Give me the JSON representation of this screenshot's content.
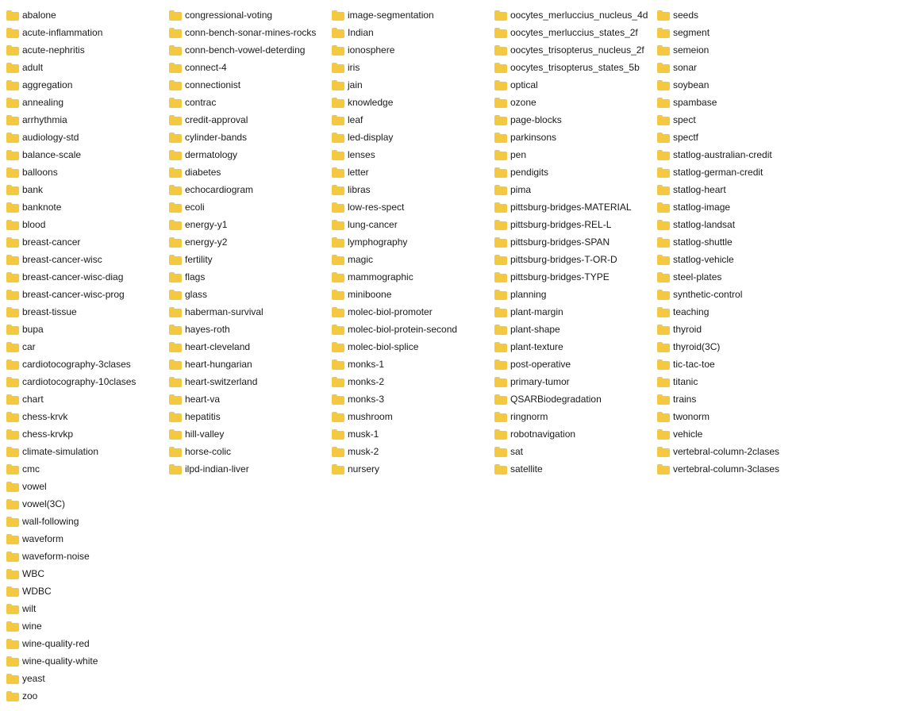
{
  "columns": [
    {
      "items": [
        "abalone",
        "acute-inflammation",
        "acute-nephritis",
        "adult",
        "aggregation",
        "annealing",
        "arrhythmia",
        "audiology-std",
        "balance-scale",
        "balloons",
        "bank",
        "banknote",
        "blood",
        "breast-cancer",
        "breast-cancer-wisc",
        "breast-cancer-wisc-diag",
        "breast-cancer-wisc-prog",
        "breast-tissue",
        "bupa",
        "car",
        "cardiotocography-3clases",
        "cardiotocography-10clases",
        "chart",
        "chess-krvk",
        "chess-krvkp",
        "climate-simulation",
        "cmc"
      ]
    },
    {
      "items": [
        "congressional-voting",
        "conn-bench-sonar-mines-rocks",
        "conn-bench-vowel-deterding",
        "connect-4",
        "connectionist",
        "contrac",
        "credit-approval",
        "cylinder-bands",
        "dermatology",
        "diabetes",
        "echocardiogram",
        "ecoli",
        "energy-y1",
        "energy-y2",
        "fertility",
        "flags",
        "glass",
        "haberman-survival",
        "hayes-roth",
        "heart-cleveland",
        "heart-hungarian",
        "heart-switzerland",
        "heart-va",
        "hepatitis",
        "hill-valley",
        "horse-colic",
        "ilpd-indian-liver"
      ]
    },
    {
      "items": [
        "image-segmentation",
        "Indian",
        "ionosphere",
        "iris",
        "jain",
        "knowledge",
        "leaf",
        "led-display",
        "lenses",
        "letter",
        "libras",
        "low-res-spect",
        "lung-cancer",
        "lymphography",
        "magic",
        "mammographic",
        "miniboone",
        "molec-biol-promoter",
        "molec-biol-protein-second",
        "molec-biol-splice",
        "monks-1",
        "monks-2",
        "monks-3",
        "mushroom",
        "musk-1",
        "musk-2",
        "nursery"
      ]
    },
    {
      "items": [
        "oocytes_merluccius_nucleus_4d",
        "oocytes_merluccius_states_2f",
        "oocytes_trisopterus_nucleus_2f",
        "oocytes_trisopterus_states_5b",
        "optical",
        "ozone",
        "page-blocks",
        "parkinsons",
        "pen",
        "pendigits",
        "pima",
        "pittsburg-bridges-MATERIAL",
        "pittsburg-bridges-REL-L",
        "pittsburg-bridges-SPAN",
        "pittsburg-bridges-T-OR-D",
        "pittsburg-bridges-TYPE",
        "planning",
        "plant-margin",
        "plant-shape",
        "plant-texture",
        "post-operative",
        "primary-tumor",
        "QSARBiodegradation",
        "ringnorm",
        "robotnavigation",
        "sat",
        "satellite"
      ]
    },
    {
      "items": [
        "seeds",
        "segment",
        "semeion",
        "sonar",
        "soybean",
        "spambase",
        "spect",
        "spectf",
        "statlog-australian-credit",
        "statlog-german-credit",
        "statlog-heart",
        "statlog-image",
        "statlog-landsat",
        "statlog-shuttle",
        "statlog-vehicle",
        "steel-plates",
        "synthetic-control",
        "teaching",
        "thyroid",
        "thyroid(3C)",
        "tic-tac-toe",
        "titanic",
        "trains",
        "twonorm",
        "vehicle",
        "vertebral-column-2clases",
        "vertebral-column-3clases"
      ]
    },
    {
      "items": [
        "vowel",
        "vowel(3C)",
        "wall-following",
        "waveform",
        "waveform-noise",
        "WBC",
        "WDBC",
        "wilt",
        "wine",
        "wine-quality-red",
        "wine-quality-white",
        "yeast",
        "zoo"
      ]
    }
  ]
}
